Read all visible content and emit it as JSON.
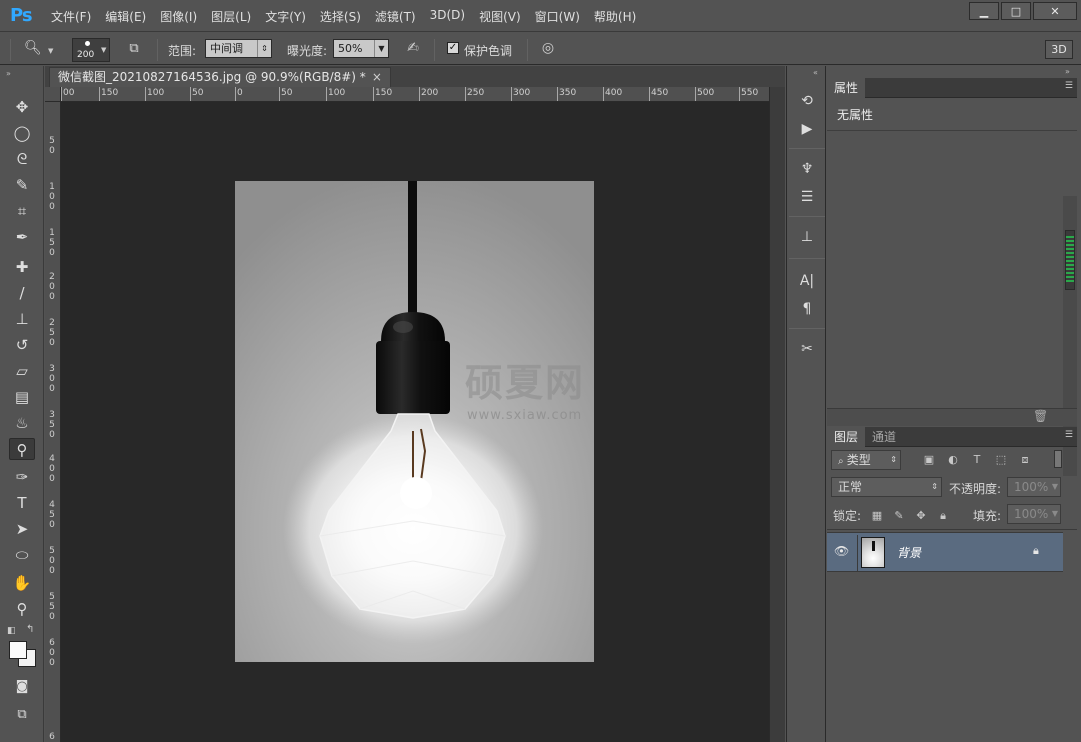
{
  "app": {
    "logo": "Ps"
  },
  "menu": [
    "文件(F)",
    "编辑(E)",
    "图像(I)",
    "图层(L)",
    "文字(Y)",
    "选择(S)",
    "滤镜(T)",
    "3D(D)",
    "视图(V)",
    "窗口(W)",
    "帮助(H)"
  ],
  "window_controls": {
    "minimize": "▁",
    "maximize": "□",
    "close": "✕"
  },
  "options": {
    "brush_size": "200",
    "range_label": "范围:",
    "range_value": "中间调",
    "exposure_label": "曝光度:",
    "exposure_value": "50%",
    "protect_label": "保护色调",
    "protect_checked": "✓",
    "btn_3d": "3D"
  },
  "document": {
    "tab_title": "微信截图_20210827164536.jpg @ 90.9%(RGB/8#) *",
    "close": "×",
    "watermark_title": "硕夏网",
    "watermark_url": "www.sxiaw.com"
  },
  "ruler_top": [
    "00",
    "150",
    "100",
    "50",
    "0",
    "50",
    "100",
    "150",
    "200",
    "250",
    "300",
    "350",
    "400",
    "450",
    "500",
    "550"
  ],
  "ruler_left": [
    [
      "5",
      "0"
    ],
    [
      "1",
      "0",
      "0"
    ],
    [
      "1",
      "5",
      "0"
    ],
    [
      "2",
      "0",
      "0"
    ],
    [
      "2",
      "5",
      "0"
    ],
    [
      "3",
      "0",
      "0"
    ],
    [
      "3",
      "5",
      "0"
    ],
    [
      "4",
      "0",
      "0"
    ],
    [
      "4",
      "5",
      "0"
    ],
    [
      "5",
      "0",
      "0"
    ],
    [
      "5",
      "5",
      "0"
    ],
    [
      "6",
      "0",
      "0"
    ],
    [
      "6"
    ]
  ],
  "properties": {
    "tab": "属性",
    "content": "无属性"
  },
  "layers": {
    "tab_layers": "图层",
    "tab_channels": "通道",
    "filter_kind": "类型",
    "blend_mode": "正常",
    "opacity_label": "不透明度:",
    "opacity_value": "100%",
    "lock_label": "锁定:",
    "fill_label": "填充:",
    "fill_value": "100%",
    "layer_name": "背景"
  },
  "colors": {
    "accent": "#31a8ff",
    "panel": "#535353",
    "canvas": "#282828",
    "selected_layer": "#5a6b80"
  }
}
